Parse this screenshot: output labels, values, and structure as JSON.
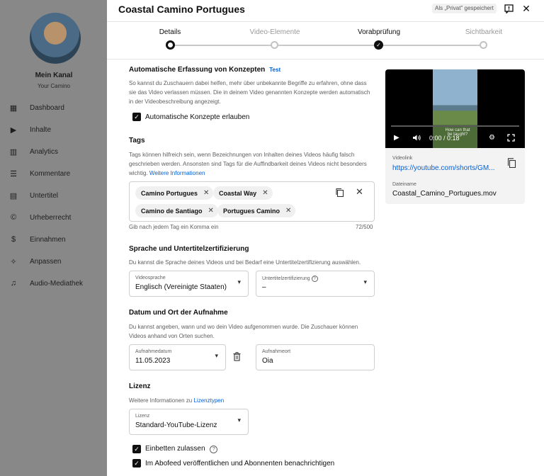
{
  "sidebar": {
    "channel_name": "Mein Kanal",
    "channel_sub": "Your Camino",
    "items": [
      {
        "label": "Dashboard",
        "icon": "dashboard-icon"
      },
      {
        "label": "Inhalte",
        "icon": "content-icon"
      },
      {
        "label": "Analytics",
        "icon": "analytics-icon"
      },
      {
        "label": "Kommentare",
        "icon": "comments-icon"
      },
      {
        "label": "Untertitel",
        "icon": "subtitles-icon"
      },
      {
        "label": "Urheberrecht",
        "icon": "copyright-icon"
      },
      {
        "label": "Einnahmen",
        "icon": "dollar-icon"
      },
      {
        "label": "Anpassen",
        "icon": "magic-wand-icon"
      },
      {
        "label": "Audio-Mediathek",
        "icon": "audio-library-icon"
      }
    ]
  },
  "dialog": {
    "title": "Coastal Camino Portugues",
    "saved_status": "Als „Privat\" gespeichert"
  },
  "steps": [
    {
      "label": "Details",
      "state": "current"
    },
    {
      "label": "Video-Elemente",
      "state": "todo"
    },
    {
      "label": "Vorabprüfung",
      "state": "checked"
    },
    {
      "label": "Sichtbarkeit",
      "state": "todo"
    }
  ],
  "concepts": {
    "title": "Automatische Erfassung von Konzepten",
    "badge": "Test",
    "description": "So kannst du Zuschauern dabei helfen, mehr über unbekannte Begriffe zu erfahren, ohne dass sie das Video verlassen müssen. Die in deinem Video genannten Konzepte werden automatisch in der Videobeschreibung angezeigt.",
    "checkbox_label": "Automatische Konzepte erlauben",
    "checked": true
  },
  "tags": {
    "title": "Tags",
    "description": "Tags können hilfreich sein, wenn Bezeichnungen von Inhalten deines Videos häufig falsch geschrieben werden. Ansonsten sind Tags für die Auffindbarkeit deines Videos nicht besonders wichtig.",
    "more_link": "Weitere Informationen",
    "items": [
      "Camino Portugues",
      "Coastal Way",
      "Camino de Santiago",
      "Portugues Camino"
    ],
    "hint": "Gib nach jedem Tag ein Komma ein",
    "counter": "72/500"
  },
  "language": {
    "title": "Sprache und Untertitelzertifizierung",
    "description": "Du kannst die Sprache deines Videos und bei Bedarf eine Untertitelzertifizierung auswählen.",
    "video_language_label": "Videosprache",
    "video_language_value": "Englisch (Vereinigte Staaten)",
    "cert_label": "Untertitelzertifizierung",
    "cert_value": "–"
  },
  "recording": {
    "title": "Datum und Ort der Aufnahme",
    "description": "Du kannst angeben, wann und wo dein Video aufgenommen wurde. Die Zuschauer können Videos anhand von Orten suchen.",
    "date_label": "Aufnahmedatum",
    "date_value": "11.05.2023",
    "location_label": "Aufnahmeort",
    "location_value": "Oia"
  },
  "license": {
    "title": "Lizenz",
    "description_prefix": "Weitere Informationen zu",
    "description_link": "Lizenztypen",
    "field_label": "Lizenz",
    "field_value": "Standard-YouTube-Lizenz",
    "embed_label": "Einbetten zulassen",
    "embed_checked": true,
    "feed_label": "Im Abofeed veröffentlichen und Abonnenten benachrichtigen",
    "feed_checked": true
  },
  "preview": {
    "overlay_text": "How can that be taught?",
    "time": "0:00 / 0:18",
    "video_link_label": "Videolink",
    "video_link": "https://youtube.com/shorts/GM...",
    "filename_label": "Dateiname",
    "filename": "Coastal_Camino_Portugues.mov"
  }
}
